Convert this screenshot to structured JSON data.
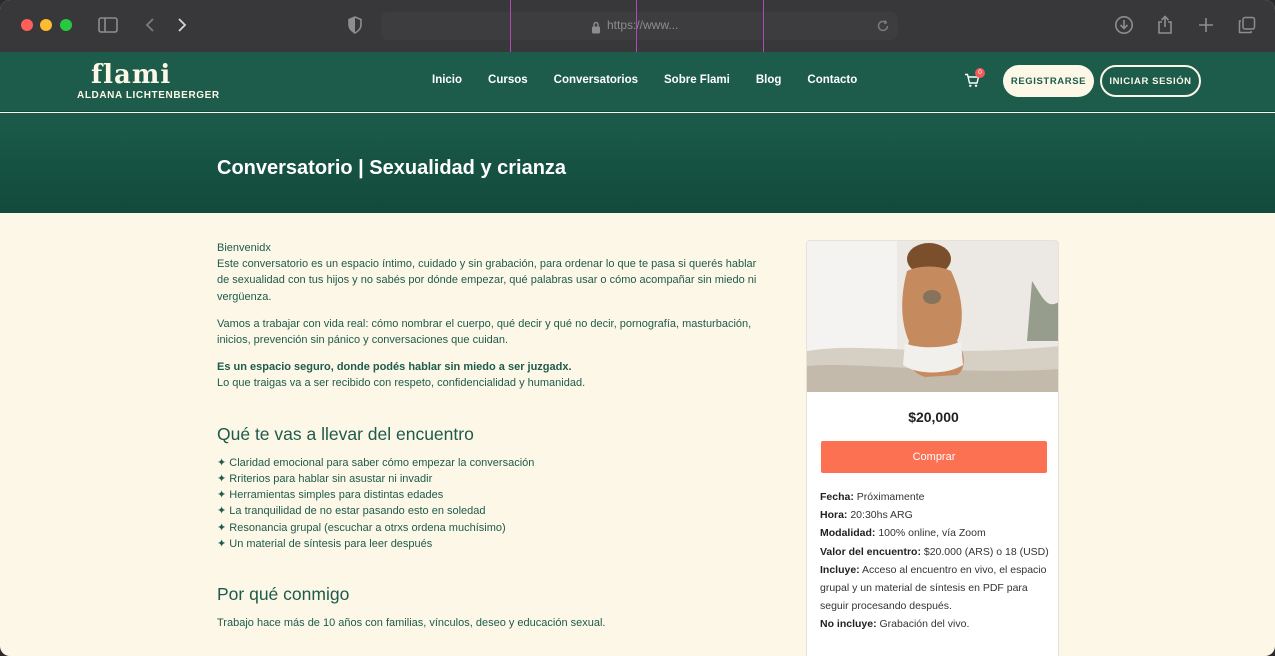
{
  "browser": {
    "url": "https://www..."
  },
  "site": {
    "logo_word": "flami",
    "logo_sub": "ALDANA LICHTENBERGER",
    "nav": [
      "Inicio",
      "Cursos",
      "Conversatorios",
      "Sobre Flami",
      "Blog",
      "Contacto"
    ],
    "cart_count": "0",
    "register_label": "REGISTRARSE",
    "login_label": "INICIAR SESIÓN"
  },
  "hero": {
    "title": "Conversatorio | Sexualidad y crianza"
  },
  "content": {
    "greeting": "Bienvenidx",
    "intro": "Este conversatorio es un espacio íntimo, cuidado y sin grabación, para ordenar lo que te pasa si querés hablar de sexualidad con tus hijos y no sabés por dónde empezar, qué palabras usar o cómo acompañar sin miedo ni vergüenza.",
    "topics": "Vamos a trabajar con vida real: cómo nombrar el cuerpo, qué decir y qué no decir, pornografía, masturbación, inicios, prevención sin pánico y conversaciones que cuidan.",
    "safe_bold": "Es un espacio seguro, donde podés hablar sin miedo a ser juzgadx.",
    "safe_text": "Lo que traigas va a ser recibido con respeto, confidencialidad y humanidad.",
    "section1_title": "Qué te vas a llevar del encuentro",
    "takeaways": [
      "Claridad emocional para saber cómo empezar la conversación",
      "Rriterios para hablar sin asustar ni invadir",
      "Herramientas simples para distintas edades",
      "La tranquilidad de no estar pasando esto en soledad",
      "Resonancia grupal (escuchar a otrxs ordena muchísimo)",
      "Un material de síntesis para leer después"
    ],
    "section2_title": "Por qué conmigo",
    "why_text": "Trabajo hace más de 10 años con familias, vínculos, deseo y educación sexual."
  },
  "card": {
    "price": "$20,000",
    "buy_label": "Comprar",
    "details": [
      {
        "label": "Fecha:",
        "value": "Próximamente"
      },
      {
        "label": "Hora:",
        "value": "20:30hs ARG"
      },
      {
        "label": "Modalidad:",
        "value": "100% online, vía Zoom"
      },
      {
        "label": "Valor del encuentro:",
        "value": "$20.000 (ARS) o 18 (USD)"
      },
      {
        "label": "Incluye:",
        "value": "Acceso al encuentro en vivo, el espacio grupal y un material de síntesis en PDF para seguir procesando después."
      },
      {
        "label": "No incluye:",
        "value": "Grabación del vivo."
      }
    ]
  },
  "colors": {
    "brand_green": "#1d5b4a",
    "cream": "#fdf7e8",
    "buy_orange": "#fb7152"
  }
}
